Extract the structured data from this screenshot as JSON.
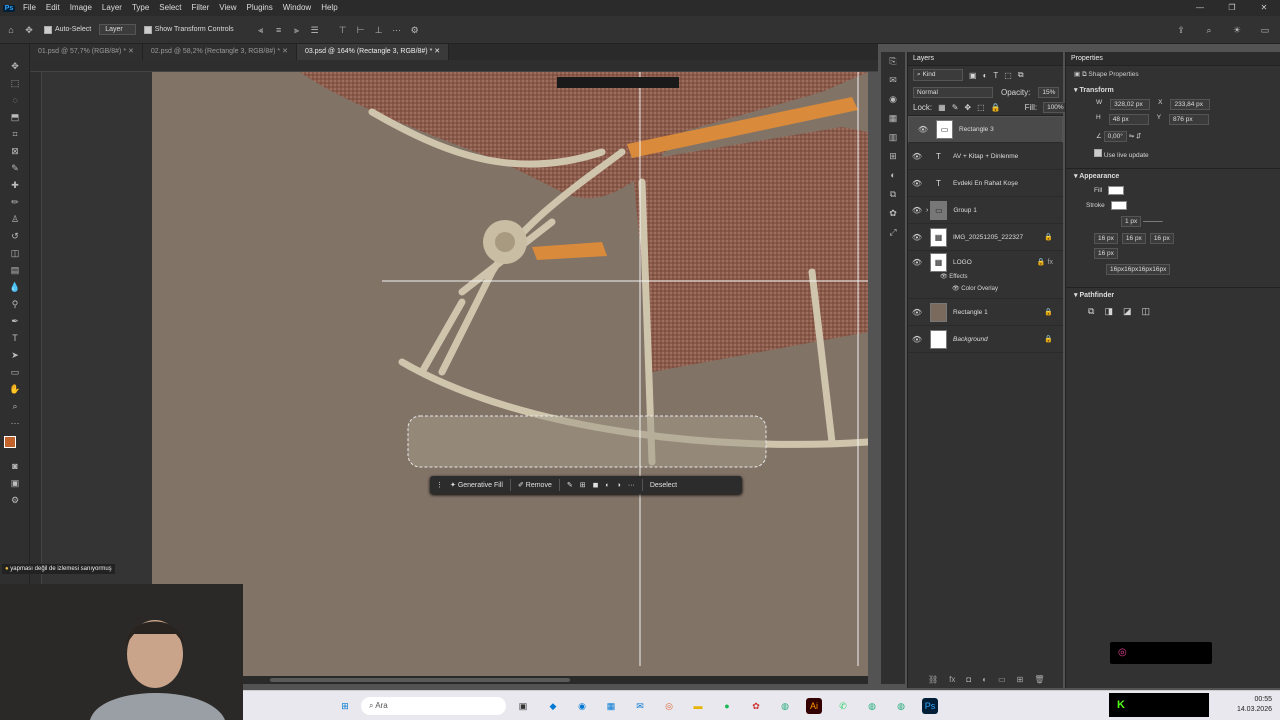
{
  "app": {
    "logo": "Ps"
  },
  "menu": [
    "File",
    "Edit",
    "Image",
    "Layer",
    "Type",
    "Select",
    "Filter",
    "View",
    "Plugins",
    "Window",
    "Help"
  ],
  "options": {
    "auto_select": "Auto-Select",
    "layer_select": "Layer",
    "transform_controls": "Show Transform Controls"
  },
  "tabs": [
    "01.psd @ 57,7% (RGB/8#) *",
    "02.psd @ 58,2% (Rectangle 3, RGB/8#) *",
    "03.psd @ 164% (Rectangle 3, RGB/8#) *"
  ],
  "context_bar": {
    "generative_fill": "Generative Fill",
    "remove": "Remove",
    "deselect": "Deselect"
  },
  "layers_panel": {
    "title": "Layers",
    "filter": "Kind",
    "blend_mode": "Normal",
    "opacity_label": "Opacity:",
    "opacity_value": "15%",
    "lock_label": "Lock:",
    "fill_label": "Fill:",
    "fill_value": "100%",
    "layers": [
      {
        "name": "Rectangle 3",
        "type": "shape",
        "locked": false
      },
      {
        "name": "AV + Kitap + Dinlenme",
        "type": "text",
        "locked": false
      },
      {
        "name": "Evdeki En Rahat Koşe",
        "type": "text",
        "locked": false
      },
      {
        "name": "Group 1",
        "type": "group",
        "locked": false
      },
      {
        "name": "IMG_20251205_222327",
        "type": "image",
        "locked": true
      },
      {
        "name": "LOGO",
        "type": "image",
        "locked": true
      },
      {
        "name": "Rectangle 1",
        "type": "shape",
        "locked": true
      },
      {
        "name": "Background",
        "type": "bg",
        "locked": true
      }
    ],
    "effects_label": "Effects",
    "color_overlay": "Color Overlay"
  },
  "properties": {
    "title": "Properties",
    "subtitle": "Shape Properties",
    "transform": "Transform",
    "w_label": "W",
    "w": "328,02 px",
    "x_label": "X",
    "x": "233,84 px",
    "h_label": "H",
    "h": "48 px",
    "y_label": "Y",
    "y": "876 px",
    "angle": "0,00°",
    "live_update": "Use live update",
    "appearance": "Appearance",
    "fill_label": "Fill",
    "stroke_label": "Stroke",
    "stroke_size": "1 px",
    "radius": [
      "16 px",
      "16 px",
      "16 px",
      "16 px"
    ],
    "radius_text": "16px16px16px16px",
    "pathfinder": "Pathfinder"
  },
  "overlay_text": "yapması değil de izlemesi sanıyormuş",
  "taskbar": {
    "search_placeholder": "Ara",
    "time": "00:55",
    "date": "14.03.2026"
  },
  "colors": {
    "ui_bg": "#535353",
    "panel": "#323232",
    "fg_color": "#c0622a",
    "bg_color": "#000000"
  }
}
